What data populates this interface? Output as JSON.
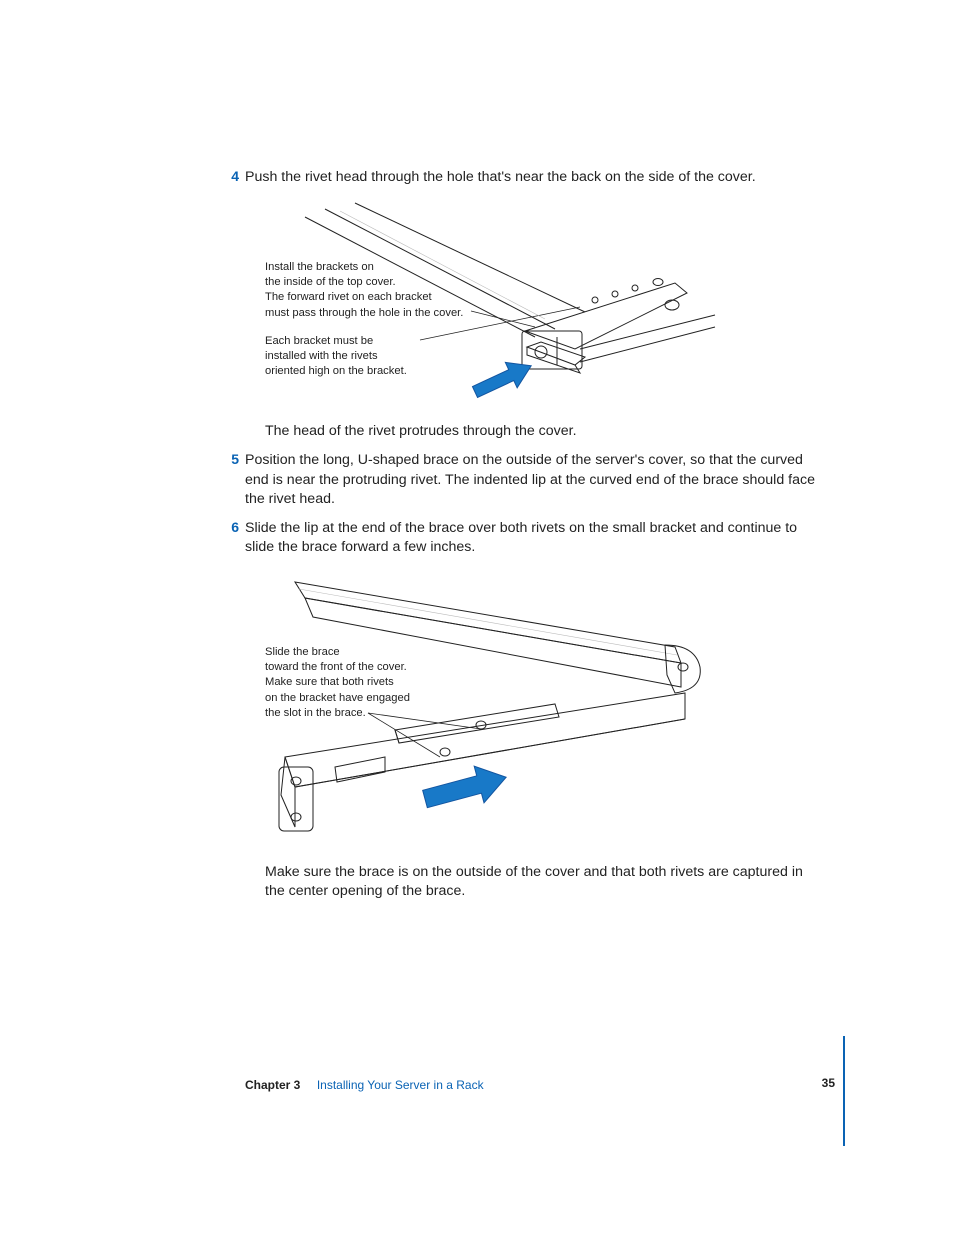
{
  "steps": {
    "s4": {
      "num": "4",
      "text": "Push the rivet head through the hole that's near the back on the side of the cover."
    },
    "s5": {
      "num": "5",
      "text": "Position the long, U-shaped brace on the outside of the server's cover, so that the curved end is near the protruding rivet. The indented lip at the curved end of the brace should face the rivet head."
    },
    "s6": {
      "num": "6",
      "text": "Slide the lip at the end of the brace over both rivets on the small bracket and continue to slide the brace forward a few inches."
    }
  },
  "para": {
    "afterFig1": "The head of the rivet protrudes through the cover.",
    "afterFig2": "Make sure the brace is on the outside of the cover and that both rivets are captured in the center opening of the brace."
  },
  "callouts": {
    "fig1a_l1": "Install the brackets on",
    "fig1a_l2": "the inside of the top cover.",
    "fig1a_l3": "The forward rivet on each bracket",
    "fig1a_l4": "must pass through the hole in the cover.",
    "fig1b_l1": "Each bracket must be",
    "fig1b_l2": "installed with the rivets",
    "fig1b_l3": "oriented high on the bracket.",
    "fig2_l1": "Slide the brace",
    "fig2_l2": "toward the front of the cover.",
    "fig2_l3": "Make sure that both rivets",
    "fig2_l4": "on the bracket have engaged",
    "fig2_l5": "the slot in the brace."
  },
  "footer": {
    "chapter": "Chapter 3",
    "title": "Installing Your Server in a Rack",
    "page": "35"
  }
}
